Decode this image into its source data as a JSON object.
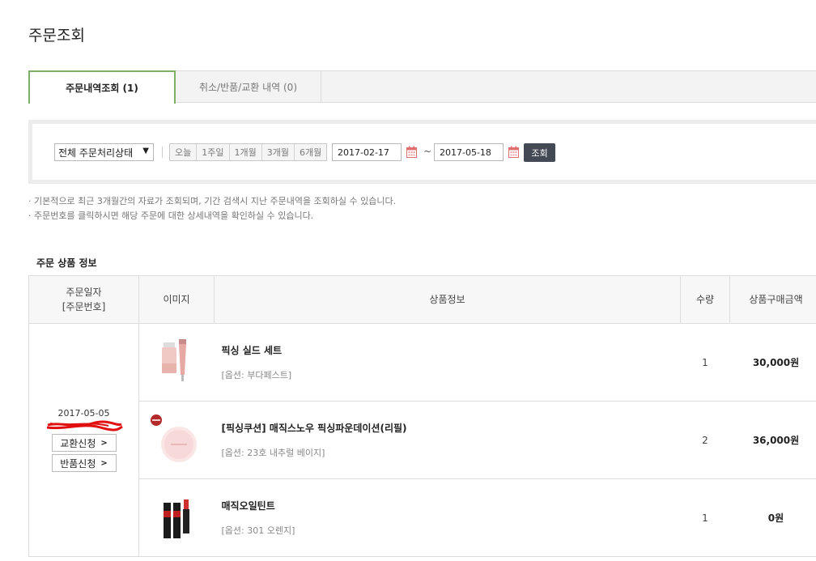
{
  "page_title": "주문조회",
  "tabs": [
    {
      "label": "주문내역조회 (1)"
    },
    {
      "label": "취소/반품/교환 내역 (0)"
    }
  ],
  "filter": {
    "status_select": "전체 주문처리상태",
    "periods": [
      "오늘",
      "1주일",
      "1개월",
      "3개월",
      "6개월"
    ],
    "date_from": "2017-02-17",
    "tilde": "~",
    "date_to": "2017-05-18",
    "search_label": "조회"
  },
  "notices": [
    "· 기본적으로 최근 3개월간의 자료가 조회되며, 기간 검색시 지난 주문내역을 조회하실 수 있습니다.",
    "· 주문번호를 클릭하시면 해당 주문에 대한 상세내역을 확인하실 수 있습니다."
  ],
  "section_title": "주문 상품 정보",
  "table": {
    "headers": {
      "date_line1": "주문일자",
      "date_line2": "[주문번호]",
      "image": "이미지",
      "info": "상품정보",
      "qty": "수량",
      "price": "상품구매금액"
    },
    "order": {
      "date": "2017-05-05",
      "exchange_label": "교환신청",
      "return_label": "반품신청"
    },
    "rows": [
      {
        "name": "픽싱 실드 세트",
        "option": "[옵션: 부다페스트]",
        "qty": "1",
        "price": "30,000원"
      },
      {
        "name": "[픽싱쿠션] 매직스노우 픽싱파운데이션(리필)",
        "option": "[옵션: 23호 내추럴 베이지]",
        "qty": "2",
        "price": "36,000원"
      },
      {
        "name": "매직오일틴트",
        "option": "[옵션: 301 오렌지]",
        "qty": "1",
        "price": "0원"
      }
    ]
  }
}
